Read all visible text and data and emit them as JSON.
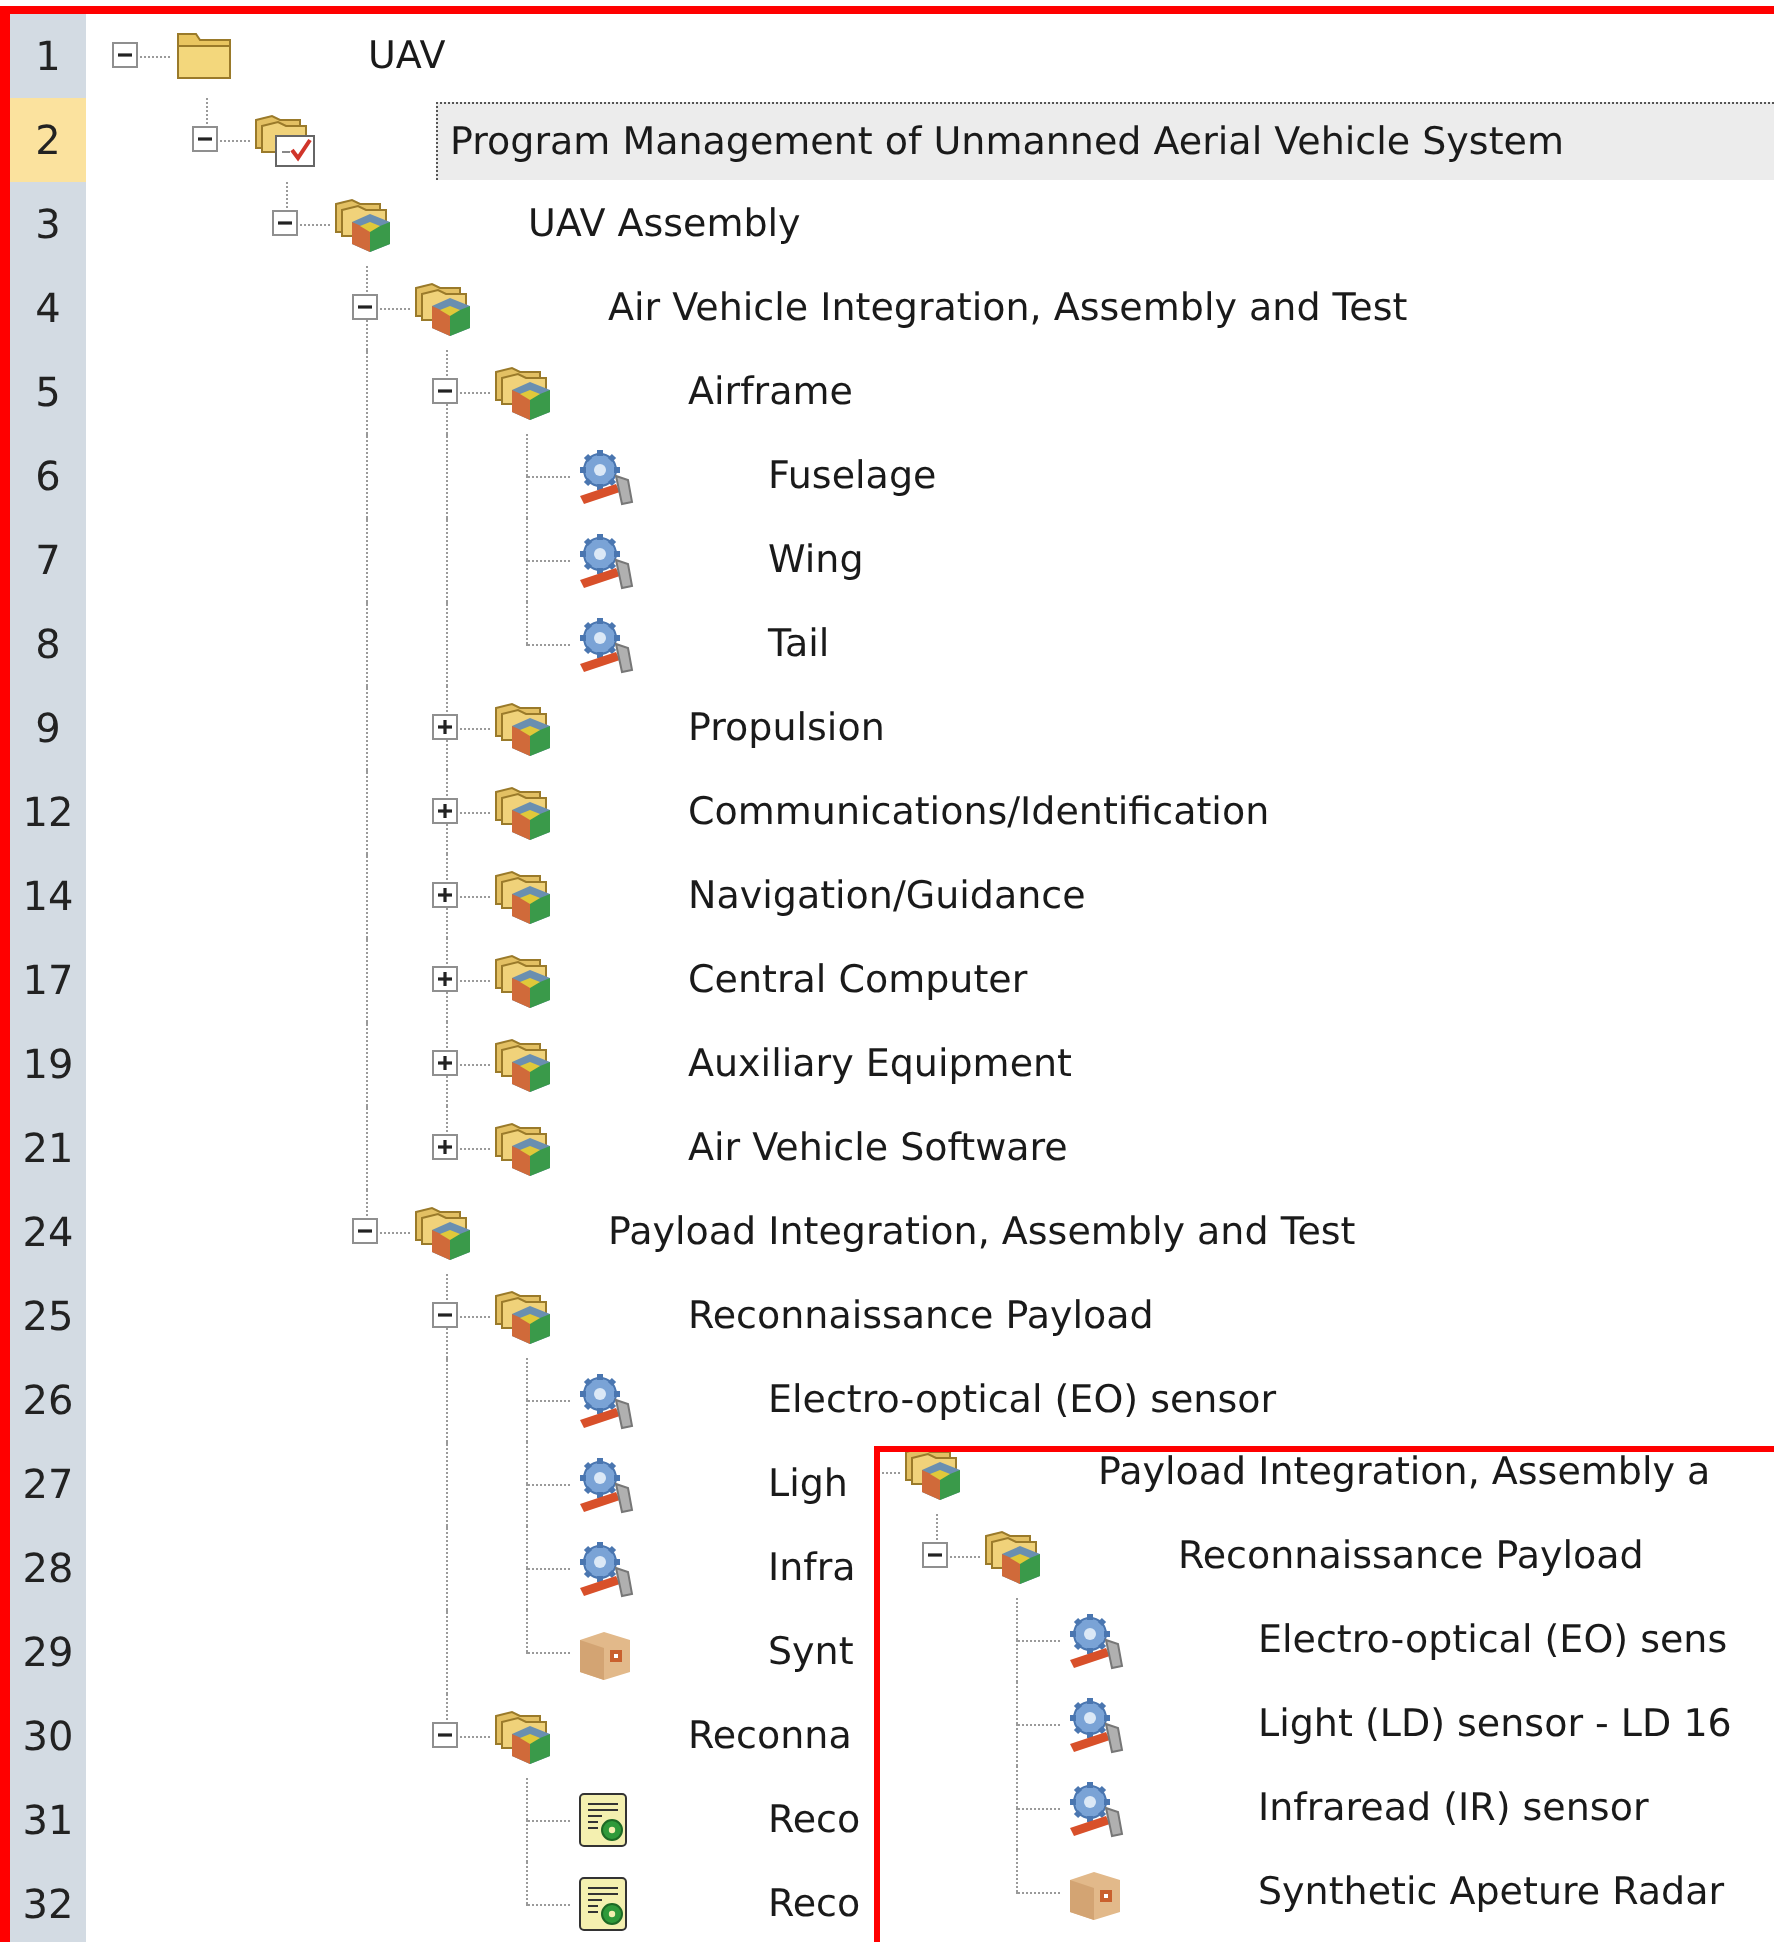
{
  "tree": {
    "items": [
      {
        "row": "1",
        "label": "UAV",
        "kind": "folder",
        "expanded": true,
        "selected": false,
        "children": [
          {
            "row": "2",
            "label": "Program Management of Unmanned Aerial Vehicle System",
            "kind": "task-folder",
            "expanded": true,
            "selected": true,
            "children": [
              {
                "row": "3",
                "label": "UAV Assembly",
                "kind": "assembly",
                "expanded": true,
                "selected": false,
                "children": [
                  {
                    "row": "4",
                    "label": "Air Vehicle Integration, Assembly and Test",
                    "kind": "assembly",
                    "expanded": true,
                    "selected": false,
                    "children": [
                      {
                        "row": "5",
                        "label": "Airframe",
                        "kind": "assembly",
                        "expanded": true,
                        "selected": false,
                        "children": [
                          {
                            "row": "6",
                            "label": "Fuselage",
                            "kind": "part",
                            "selected": false
                          },
                          {
                            "row": "7",
                            "label": "Wing",
                            "kind": "part",
                            "selected": false
                          },
                          {
                            "row": "8",
                            "label": "Tail",
                            "kind": "part",
                            "selected": false
                          }
                        ]
                      },
                      {
                        "row": "9",
                        "label": "Propulsion",
                        "kind": "assembly",
                        "expanded": false,
                        "selected": false
                      },
                      {
                        "row": "12",
                        "label": "Communications/Identification",
                        "kind": "assembly",
                        "expanded": false,
                        "selected": false
                      },
                      {
                        "row": "14",
                        "label": "Navigation/Guidance",
                        "kind": "assembly",
                        "expanded": false,
                        "selected": false
                      },
                      {
                        "row": "17",
                        "label": "Central Computer",
                        "kind": "assembly",
                        "expanded": false,
                        "selected": false
                      },
                      {
                        "row": "19",
                        "label": "Auxiliary Equipment",
                        "kind": "assembly",
                        "expanded": false,
                        "selected": false
                      },
                      {
                        "row": "21",
                        "label": "Air Vehicle Software",
                        "kind": "assembly",
                        "expanded": false,
                        "selected": false
                      }
                    ]
                  },
                  {
                    "row": "24",
                    "label": "Payload Integration, Assembly and Test",
                    "kind": "assembly",
                    "expanded": true,
                    "selected": false,
                    "children": [
                      {
                        "row": "25",
                        "label": "Reconnaissance Payload",
                        "kind": "assembly",
                        "expanded": true,
                        "selected": false,
                        "children": [
                          {
                            "row": "26",
                            "label": "Electro-optical (EO) sensor",
                            "kind": "part",
                            "selected": false
                          },
                          {
                            "row": "27",
                            "label": "Ligh",
                            "kind": "part",
                            "selected": false
                          },
                          {
                            "row": "28",
                            "label": "Infra",
                            "kind": "part",
                            "selected": false
                          },
                          {
                            "row": "29",
                            "label": "Synt",
                            "kind": "package",
                            "selected": false
                          }
                        ]
                      },
                      {
                        "row": "30",
                        "label": "Reconna",
                        "kind": "assembly",
                        "expanded": true,
                        "selected": false,
                        "children": [
                          {
                            "row": "31",
                            "label": "Reco",
                            "kind": "document",
                            "selected": false
                          },
                          {
                            "row": "32",
                            "label": "Reco",
                            "kind": "document",
                            "selected": false
                          }
                        ]
                      }
                    ]
                  }
                ]
              }
            ]
          }
        ]
      }
    ]
  },
  "inset": {
    "items": [
      {
        "label": "Payload Integration, Assembly a",
        "kind": "assembly",
        "children": [
          {
            "label": "Reconnaissance Payload",
            "kind": "assembly",
            "expanded": true,
            "children": [
              {
                "label": "Electro-optical (EO) sens",
                "kind": "part"
              },
              {
                "label": "Light (LD) sensor - LD 16",
                "kind": "part"
              },
              {
                "label": "Infraread (IR) sensor",
                "kind": "part"
              },
              {
                "label": "Synthetic Apeture Radar",
                "kind": "package"
              }
            ]
          }
        ]
      }
    ]
  }
}
